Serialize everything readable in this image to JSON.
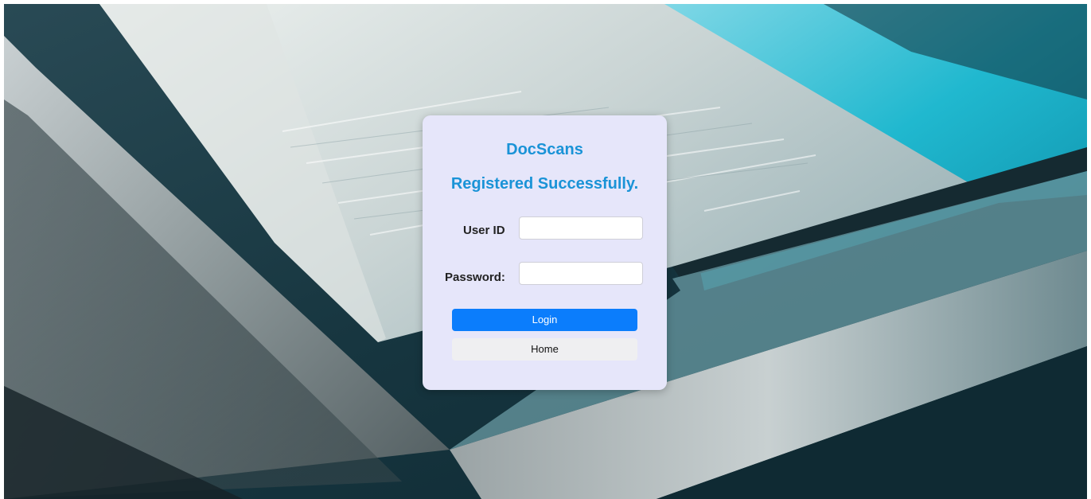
{
  "app": {
    "brand": "DocScans",
    "status_message": "Registered Successfully."
  },
  "form": {
    "user_id_label": "User ID",
    "user_id_value": "",
    "password_label": "Password:",
    "password_value": "",
    "login_label": "Login",
    "home_label": "Home"
  },
  "colors": {
    "card_background": "#e6e6fa",
    "heading": "#1a93d7",
    "login_button": "#0b7dfc",
    "home_button": "#efeff1"
  },
  "icons": {
    "background": "scanner-photo-background"
  }
}
